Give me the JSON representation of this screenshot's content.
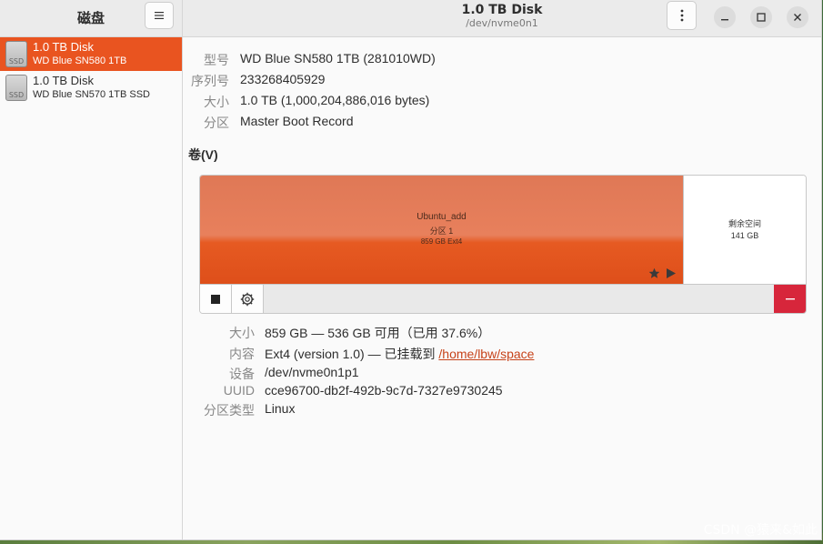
{
  "sidebar": {
    "title": "磁盘",
    "menu_icon": "hamburger-menu-icon",
    "disks": [
      {
        "name": "1.0 TB Disk",
        "model": "WD Blue SN580 1TB",
        "icon_label": "SSD",
        "selected": true
      },
      {
        "name": "1.0 TB Disk",
        "model": "WD Blue SN570 1TB SSD",
        "icon_label": "SSD",
        "selected": false
      }
    ]
  },
  "header": {
    "title": "1.0 TB Disk",
    "subtitle": "/dev/nvme0n1",
    "menu_icon": "vertical-dots-menu-icon"
  },
  "disk_info": {
    "model_label": "型号",
    "model": "WD Blue SN580 1TB (281010WD)",
    "serial_label": "序列号",
    "serial": "233268405929",
    "size_label": "大小",
    "size": "1.0 TB (1,000,204,886,016 bytes)",
    "partitioning_label": "分区",
    "partitioning": "Master Boot Record"
  },
  "volumes": {
    "title": "卷(V)",
    "partition": {
      "name": "Ubuntu_add",
      "number": "分区 1",
      "summary": "859 GB Ext4"
    },
    "free_space": {
      "label": "剩余空间",
      "size": "141 GB"
    }
  },
  "volume_info": {
    "size_label": "大小",
    "size": "859 GB — 536 GB 可用（已用 37.6%）",
    "contents_label": "内容",
    "contents": "Ext4 (version 1.0) — 已挂载到 ",
    "mount_point": "/home/lbw/space",
    "device_label": "设备",
    "device": "/dev/nvme0n1p1",
    "uuid_label": "UUID",
    "uuid": "cce96700-db2f-492b-9c7d-7327e9730245",
    "type_label": "分区类型",
    "type": "Linux"
  },
  "watermark": "CSDN @猿来&如此",
  "colors": {
    "accent": "#e95420",
    "danger": "#d7263b"
  }
}
